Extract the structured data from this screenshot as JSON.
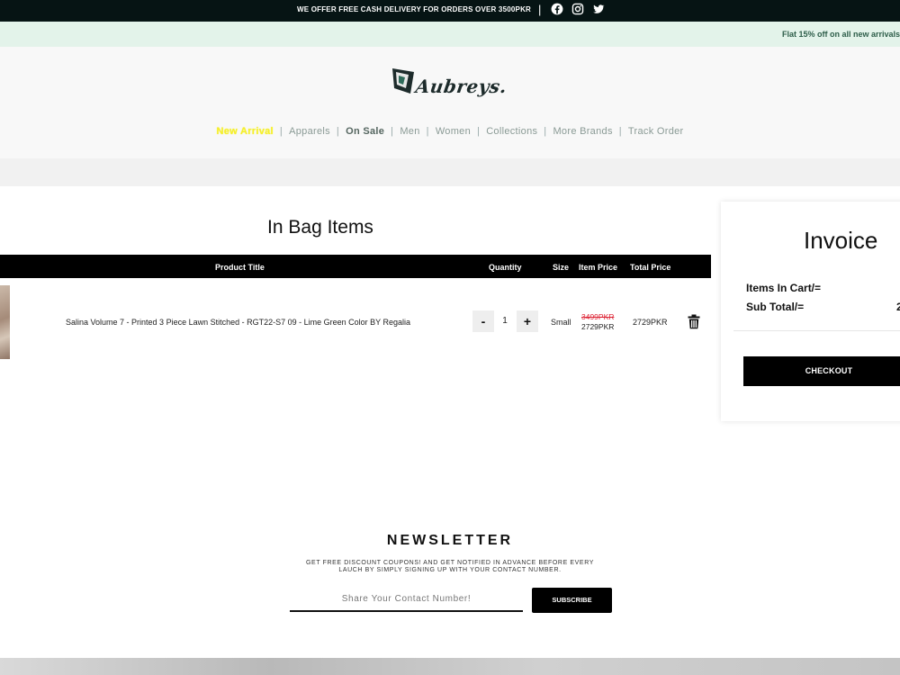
{
  "topbar": {
    "message": "WE OFFER FREE CASH DELIVERY FOR ORDERS OVER 3500PKR",
    "separator": "|",
    "social_icons": [
      "facebook-icon",
      "instagram-icon",
      "twitter-icon"
    ]
  },
  "promo": {
    "text": "Flat 15% off on all new arrivals"
  },
  "logo": {
    "wordmark": "Aubreys."
  },
  "nav": {
    "items": [
      {
        "label": "New Arrival"
      },
      {
        "label": "Apparels"
      },
      {
        "label": "On Sale"
      },
      {
        "label": "Men"
      },
      {
        "label": "Women"
      },
      {
        "label": "Collections"
      },
      {
        "label": "More Brands"
      },
      {
        "label": "Track Order"
      }
    ],
    "separator": "|"
  },
  "bag": {
    "title": "In Bag Items",
    "columns": {
      "product_title": "Product Title",
      "quantity": "Quantity",
      "size": "Size",
      "item_price": "Item Price",
      "total_price": "Total Price"
    },
    "items": [
      {
        "title": "Salina Volume 7 - Printed 3 Piece Lawn Stitched - RGT22-S7 09 - Lime Green Color BY Regalia",
        "quantity": "1",
        "size": "Small",
        "original_price": "3499PKR",
        "item_price": "2729PKR",
        "total_price": "2729PKR",
        "decrement": "-",
        "increment": "+"
      }
    ]
  },
  "invoice": {
    "title": "Invoice",
    "items_in_cart_label": "Items In Cart/=",
    "sub_total_label": "Sub Total/=",
    "sub_total_value": "2",
    "checkout_label": "CHECKOUT"
  },
  "newsletter": {
    "title": "NEWSLETTER",
    "description": "GET FREE DISCOUNT COUPONS! AND GET NOTIFIED IN ADVANCE BEFORE EVERY LAUCH BY SIMPLY SIGNING UP WITH YOUR CONTACT NUMBER.",
    "placeholder": "Share Your Contact Number!",
    "button": "SUBSCRIBE"
  },
  "colors": {
    "topbar_bg": "#061414",
    "promo_bg": "#e3f3ea",
    "nav_highlight": "#f5ef2a",
    "price_strike": "#dd2233"
  }
}
